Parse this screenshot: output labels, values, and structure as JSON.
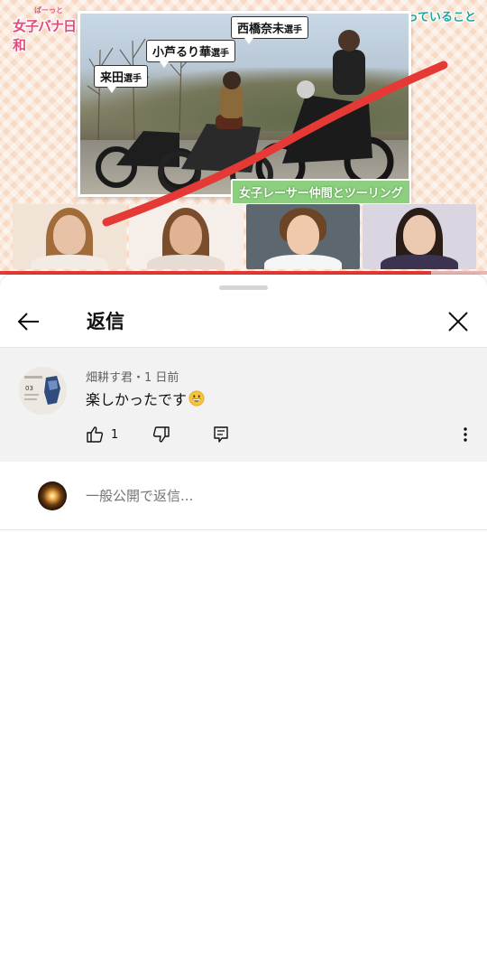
{
  "video": {
    "show_logo_small": "ぱーっと",
    "show_logo": "女子バナ日和",
    "topic": "最近ハマっていること",
    "photo_labels": [
      {
        "name": "来田",
        "suffix": "選手"
      },
      {
        "name": "小芦るり華",
        "suffix": "選手"
      },
      {
        "name": "西橋奈未",
        "suffix": "選手"
      }
    ],
    "caption": "女子レーサー仲間とツーリング",
    "progress": 0.885,
    "colors": {
      "accent_red": "#e53935",
      "caption_green": "#8ccf7e",
      "topic_teal": "#22a59b",
      "logo_pink": "#e24b7e"
    }
  },
  "sheet": {
    "title": "返信",
    "back_icon": "arrow-left-icon",
    "close_icon": "close-icon"
  },
  "comment": {
    "author": "畑耕す君",
    "separator": "・",
    "time": "1 日前",
    "text": "楽しかったです",
    "emoji": "grinning-face-emoji",
    "like_count": "1",
    "avatar_text": "03"
  },
  "reply": {
    "placeholder": "一般公開で返信..."
  }
}
